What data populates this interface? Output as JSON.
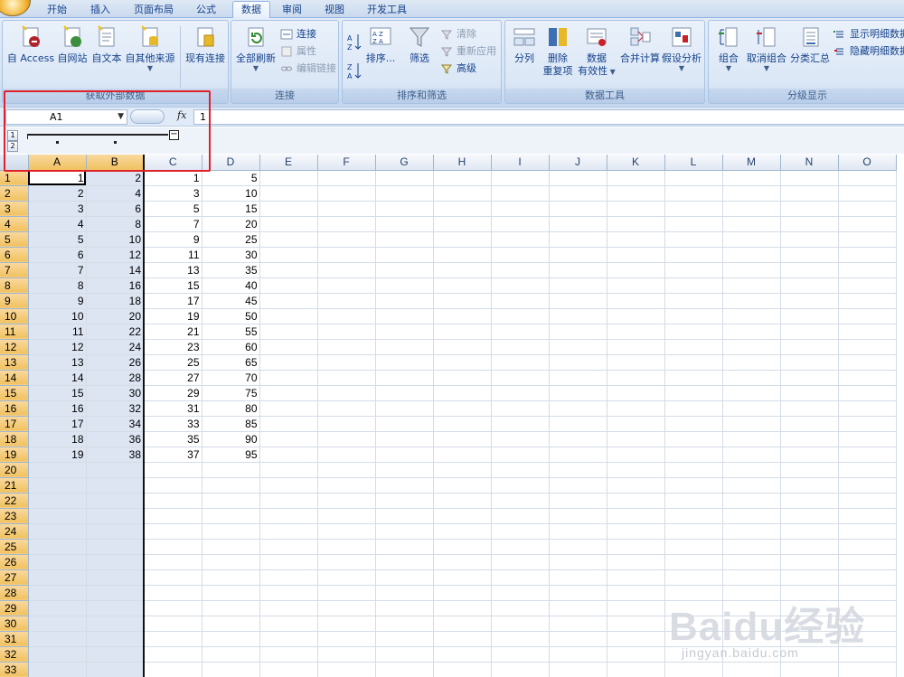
{
  "tabs": [
    {
      "label": "开始"
    },
    {
      "label": "插入"
    },
    {
      "label": "页面布局"
    },
    {
      "label": "公式"
    },
    {
      "label": "数据",
      "active": true
    },
    {
      "label": "审阅"
    },
    {
      "label": "视图"
    },
    {
      "label": "开发工具"
    }
  ],
  "ribbon": {
    "external": {
      "label": "获取外部数据",
      "access": "自 Access",
      "web": "自网站",
      "text": "自文本",
      "other": "自其他来源",
      "existing": "现有连接"
    },
    "connections": {
      "label": "连接",
      "refresh": "全部刷新",
      "conn": "连接",
      "props": "属性",
      "editlinks": "编辑链接"
    },
    "sortfilter": {
      "label": "排序和筛选",
      "sort": "排序...",
      "filter": "筛选",
      "clear": "清除",
      "reapply": "重新应用",
      "advanced": "高级"
    },
    "datatools": {
      "label": "数据工具",
      "split": "分列",
      "dedupe_1": "删除",
      "dedupe_2": "重复项",
      "validation_1": "数据",
      "validation_2": "有效性",
      "consolidate": "合并计算",
      "whatif": "假设分析"
    },
    "outline": {
      "label": "分级显示",
      "group": "组合",
      "ungroup": "取消组合",
      "subtotal": "分类汇总",
      "show": "显示明细数据",
      "hide": "隐藏明细数据"
    }
  },
  "formula_bar": {
    "name_box": "A1",
    "fx": "fx",
    "value": "1"
  },
  "outline_levels": [
    "1",
    "2"
  ],
  "outline_collapse": "−",
  "columns": [
    "A",
    "B",
    "C",
    "D",
    "E",
    "F",
    "G",
    "H",
    "I",
    "J",
    "K",
    "L",
    "M",
    "N",
    "O"
  ],
  "rows": [
    [
      "1",
      "2",
      "1",
      "5"
    ],
    [
      "2",
      "4",
      "3",
      "10"
    ],
    [
      "3",
      "6",
      "5",
      "15"
    ],
    [
      "4",
      "8",
      "7",
      "20"
    ],
    [
      "5",
      "10",
      "9",
      "25"
    ],
    [
      "6",
      "12",
      "11",
      "30"
    ],
    [
      "7",
      "14",
      "13",
      "35"
    ],
    [
      "8",
      "16",
      "15",
      "40"
    ],
    [
      "9",
      "18",
      "17",
      "45"
    ],
    [
      "10",
      "20",
      "19",
      "50"
    ],
    [
      "11",
      "22",
      "21",
      "55"
    ],
    [
      "12",
      "24",
      "23",
      "60"
    ],
    [
      "13",
      "26",
      "25",
      "65"
    ],
    [
      "14",
      "28",
      "27",
      "70"
    ],
    [
      "15",
      "30",
      "29",
      "75"
    ],
    [
      "16",
      "32",
      "31",
      "80"
    ],
    [
      "17",
      "34",
      "33",
      "85"
    ],
    [
      "18",
      "36",
      "35",
      "90"
    ],
    [
      "19",
      "38",
      "37",
      "95"
    ]
  ],
  "row_count": 33,
  "watermark": {
    "logo": "Baidu经验",
    "url": "jingyan.baidu.com"
  },
  "colors": {
    "selection": "#dde5f3",
    "header_selected": "#f1c15f",
    "highlight": "#e0202a",
    "accent": "#15428b"
  }
}
